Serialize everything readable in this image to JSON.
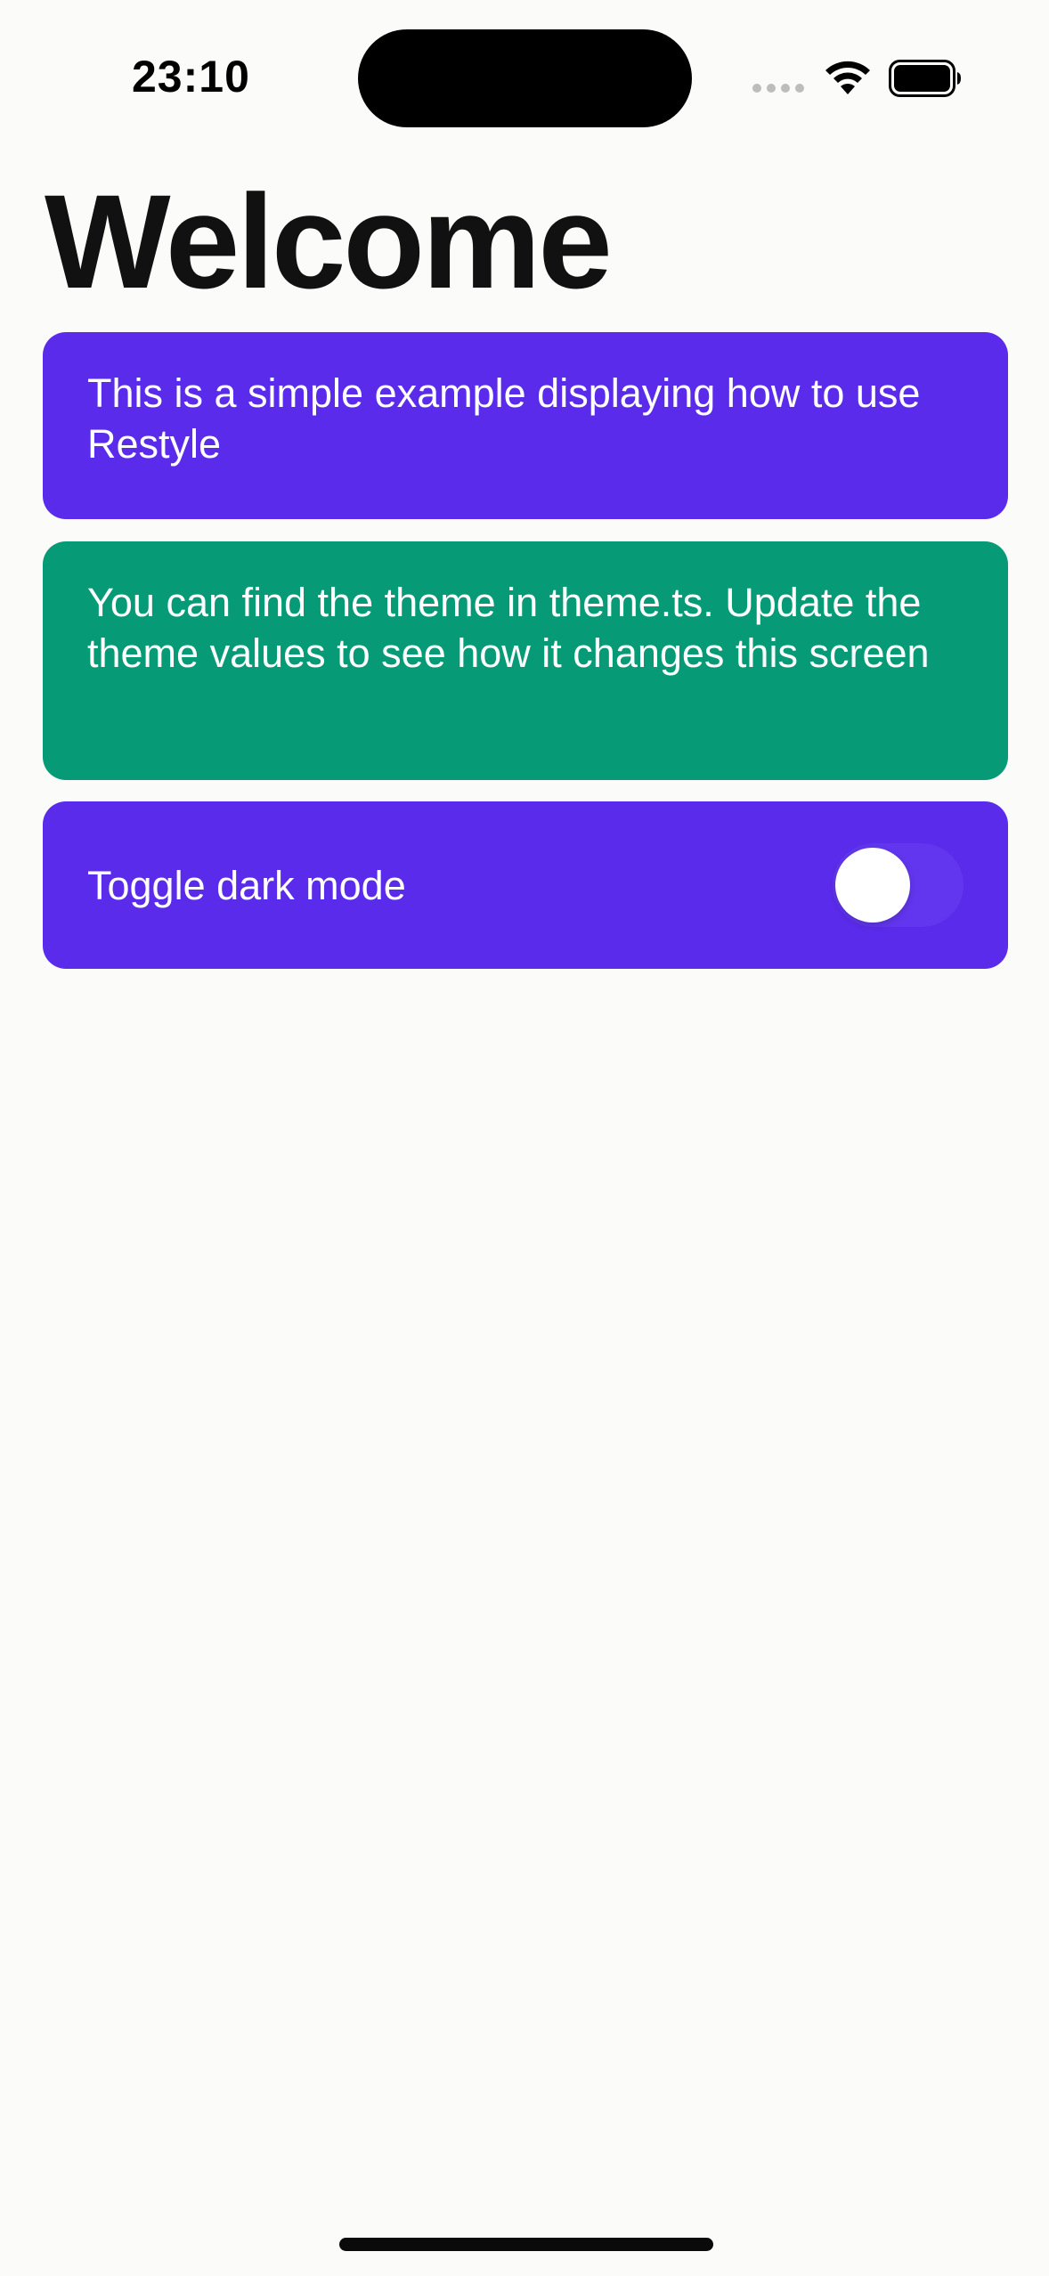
{
  "status_bar": {
    "time": "23:10"
  },
  "icons": {
    "wifi": "wifi-icon",
    "battery": "battery-icon",
    "signal": "cellular-signal-icon"
  },
  "header": {
    "title": "Welcome"
  },
  "cards": {
    "intro_text": "This is a simple example displaying how to use Restyle",
    "theme_text": "You can find the theme in theme.ts. Update the theme values to see how it changes this screen",
    "toggle_label": "Toggle dark mode"
  },
  "toggle": {
    "dark_mode_on": false
  },
  "colors": {
    "primary_card": "#5A2BEB",
    "secondary_card": "#079A76",
    "background": "#FBFBFA"
  }
}
